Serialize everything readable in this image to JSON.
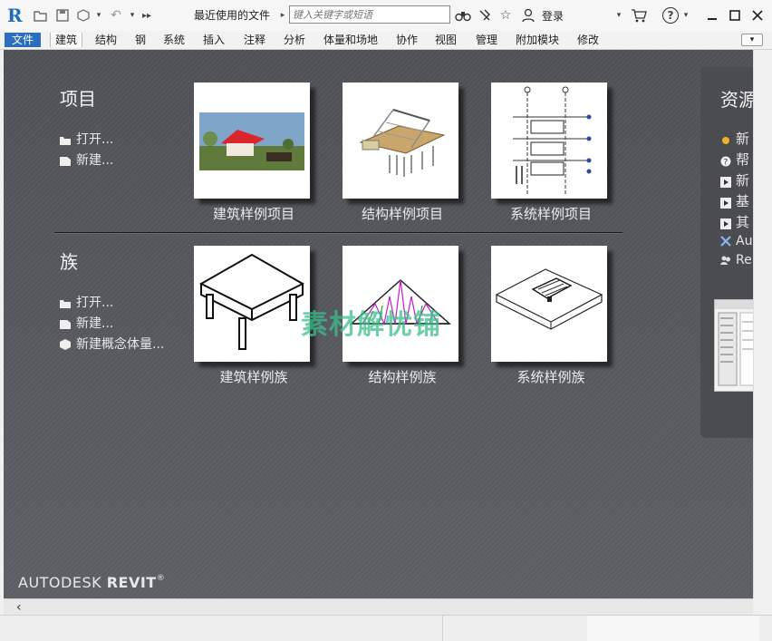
{
  "titlebar": {
    "app_logo": "R",
    "recent_files_label": "最近使用的文件",
    "search_placeholder": "键入关键字或短语",
    "login_label": "登录",
    "help_label": "?"
  },
  "ribbon": {
    "tabs": [
      {
        "label": "文件",
        "active": true
      },
      {
        "label": "建筑",
        "selected": true
      },
      {
        "label": "结构"
      },
      {
        "label": "钢"
      },
      {
        "label": "系统"
      },
      {
        "label": "插入"
      },
      {
        "label": "注释"
      },
      {
        "label": "分析"
      },
      {
        "label": "体量和场地"
      },
      {
        "label": "协作"
      },
      {
        "label": "视图"
      },
      {
        "label": "管理"
      },
      {
        "label": "附加模块"
      },
      {
        "label": "修改"
      }
    ]
  },
  "projects": {
    "title": "项目",
    "links": [
      "打开...",
      "新建..."
    ],
    "samples": [
      "建筑样例项目",
      "结构样例项目",
      "系统样例项目"
    ]
  },
  "families": {
    "title": "族",
    "links": [
      "打开...",
      "新建...",
      "新建概念体量..."
    ],
    "samples": [
      "建筑样例族",
      "结构样例族",
      "系统样例族"
    ]
  },
  "resources": {
    "title": "资源",
    "items": [
      "新",
      "帮",
      "新",
      "基",
      "其",
      "Au",
      "Re"
    ]
  },
  "brand": {
    "prefix": "AUTODESK",
    "name": "REVIT"
  },
  "watermark": "素材解忧铺",
  "colors": {
    "accent": "#2a6ebd",
    "background": "#55575c"
  }
}
